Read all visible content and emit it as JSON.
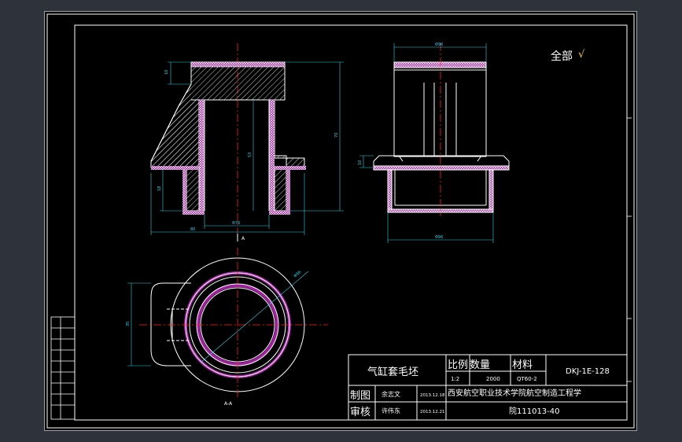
{
  "annotation": {
    "text": "全部",
    "mark": "√"
  },
  "title_block": {
    "part_name": "气缸套毛坯",
    "headers": {
      "scale": "比例",
      "quantity": "数量",
      "material": "材料"
    },
    "values": {
      "scale": "1:2",
      "quantity": "2000",
      "material": "QT60-2"
    },
    "drawing_no": "DKJ-1E-128",
    "rows": [
      {
        "role": "制图",
        "name": "余志文",
        "date": "2013.12.18"
      },
      {
        "role": "审核",
        "name": "许伟东",
        "date": "2013.12.21"
      }
    ],
    "school_line1": "西安航空职业技术学院航空制造工程学",
    "school_line2": "院111013-40"
  },
  "section_labels": {
    "section_a_top": "A",
    "section_a_bottom": "A-A"
  },
  "dimensions": {
    "d_top_right": "Φ96",
    "h_left_top": "10",
    "h_total": "70",
    "h_inner": "53",
    "h_lower": "18",
    "w_bottom": "80",
    "bore": "Φ76",
    "right_top": "Φ96",
    "right_flange": "10",
    "right_bottom": "Φ96",
    "plan_diam": "Φ96",
    "plan_left": "35"
  },
  "colors": {
    "background": "#000000",
    "outline": "#ffffff",
    "center": "#ff2020",
    "dim": "#2fd3e8",
    "hatch": "#d040d0",
    "frame": "#ffffff"
  }
}
